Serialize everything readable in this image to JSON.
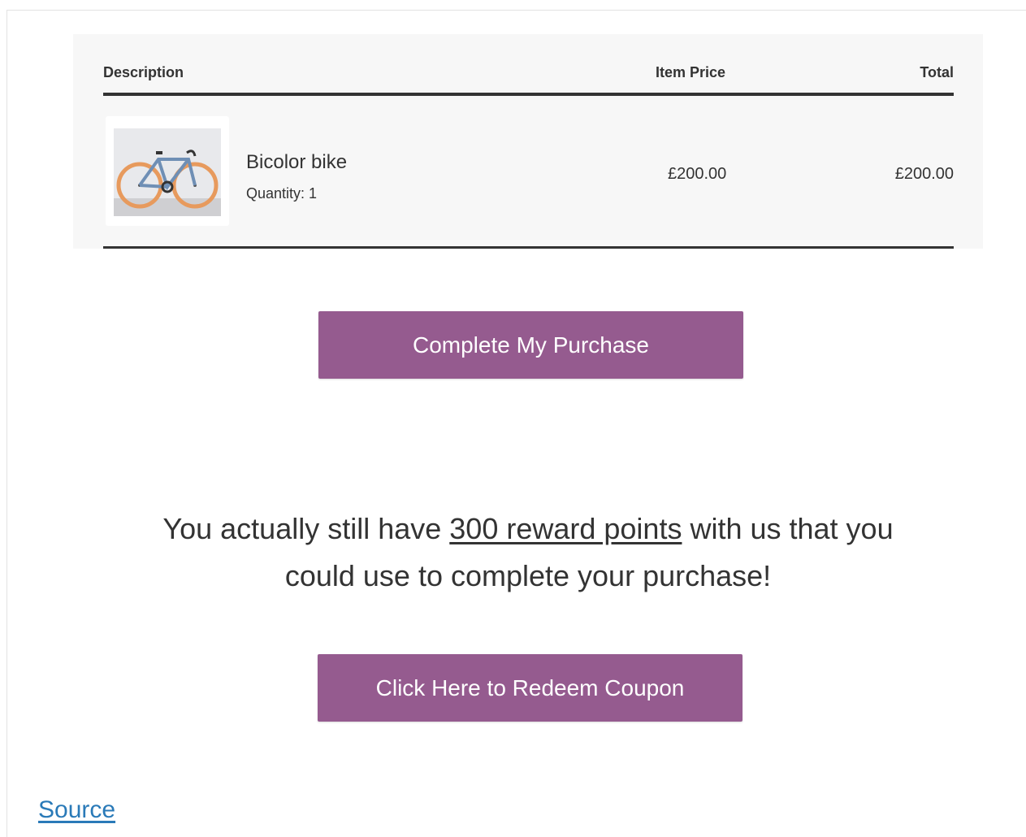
{
  "cart": {
    "headers": {
      "description": "Description",
      "item_price": "Item Price",
      "total": "Total"
    },
    "items": [
      {
        "image_icon": "bicycle-product-image",
        "name": "Bicolor bike",
        "quantity": "Quantity: 1",
        "price": "£200.00",
        "total": "£200.00"
      }
    ]
  },
  "buttons": {
    "complete_purchase": "Complete My Purchase",
    "redeem_coupon": "Click Here to Redeem Coupon"
  },
  "reward": {
    "text_before": "You actually still have ",
    "link_text": "300 reward points",
    "text_after": " with us that you could use to complete your purchase!"
  },
  "footer": {
    "source_link": "Source"
  },
  "colors": {
    "button_bg": "#955b8f",
    "button_text": "#ffffff",
    "link": "#2a7ab8",
    "panel_bg": "#f7f7f7"
  }
}
